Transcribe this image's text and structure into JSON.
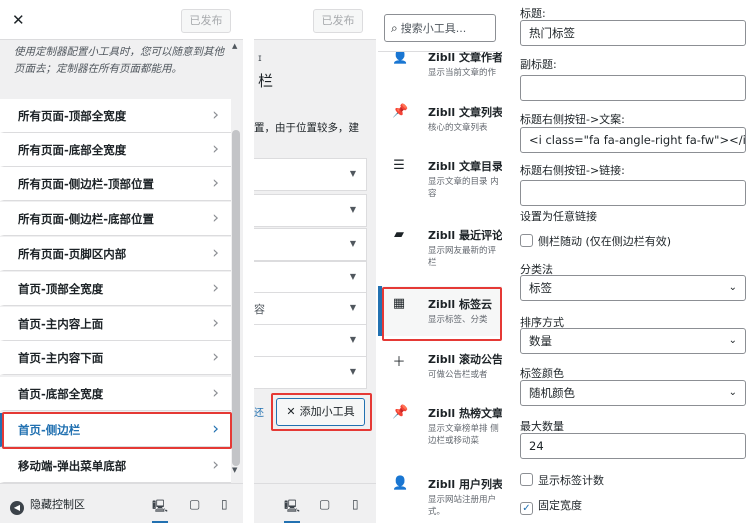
{
  "colors": {
    "accent": "#2271b1",
    "highlight": "#e53935",
    "panel_bg": "#f0f0f1"
  },
  "panel_sections": {
    "publish_label": "已发布",
    "description": "使用定制器配置小工具时，您可以随意到其他页面去；定制器在所有页面都能用。",
    "items": [
      {
        "label": "所有页面-顶部全宽度"
      },
      {
        "label": "所有页面-底部全宽度"
      },
      {
        "label": "所有页面-侧边栏-顶部位置"
      },
      {
        "label": "所有页面-侧边栏-底部位置"
      },
      {
        "label": "所有页面-页脚区内部"
      },
      {
        "label": "首页-顶部全宽度"
      },
      {
        "label": "首页-主内容上面"
      },
      {
        "label": "首页-主内容下面"
      },
      {
        "label": "首页-底部全宽度"
      },
      {
        "label": "首页-侧边栏"
      },
      {
        "label": "移动端-弹出菜单底部"
      }
    ],
    "hide_controls": "隐藏控制区"
  },
  "panel_area": {
    "publish_label": "已发布",
    "title_fragment_a": "ɪ",
    "title_fragment_b": "栏",
    "notice_fragment": "置，由于位置较多，建",
    "row_fragment": "容",
    "link_fragment": "还",
    "add_widget_label": "添加小工具"
  },
  "panel_widgets": {
    "search_placeholder": "搜索小工具...",
    "items": [
      {
        "title": "Zibll 文章作者",
        "desc": "显示当前文章的作"
      },
      {
        "title": "Zibll 文章列表",
        "desc": "核心的文章列表"
      },
      {
        "title": "Zibll 文章目录",
        "desc": "显示文章的目录 内容"
      },
      {
        "title": "Zibll 最近评论",
        "desc": "显示网友最新的评 栏"
      },
      {
        "title": "Zibll 标签云",
        "desc": "显示标签、分类"
      },
      {
        "title": "Zibll 滚动公告",
        "desc": "可做公告栏或者"
      },
      {
        "title": "Zibll 热榜文章",
        "desc": "显示文章榜单排 侧边栏或移动菜"
      },
      {
        "title": "Zibll 用户列表",
        "desc": "显示网站注册用户 式。"
      }
    ]
  },
  "panel_form": {
    "title_label": "标题:",
    "title_value": "热门标签",
    "subtitle_label": "副标题:",
    "subtitle_value": "",
    "btn_text_label": "标题右侧按钮->文案:",
    "btn_text_value": "<i class=\"fa fa-angle-right fa-fw\"></i>",
    "btn_link_label": "标题右侧按钮->链接:",
    "btn_link_value": "",
    "new_window_text": "设置为任意链接",
    "sidebar_follow_label": "侧栏随动 (仅在侧边栏有效)",
    "taxonomy_label": "分类法",
    "taxonomy_value": "标签",
    "orderby_label": "排序方式",
    "orderby_value": "数量",
    "color_label": "标签颜色",
    "color_value": "随机颜色",
    "max_label": "最大数量",
    "max_value": "24",
    "show_count_label": "显示标签计数",
    "fixed_width_label": "固定宽度",
    "fixed_width_checked": "✓"
  }
}
